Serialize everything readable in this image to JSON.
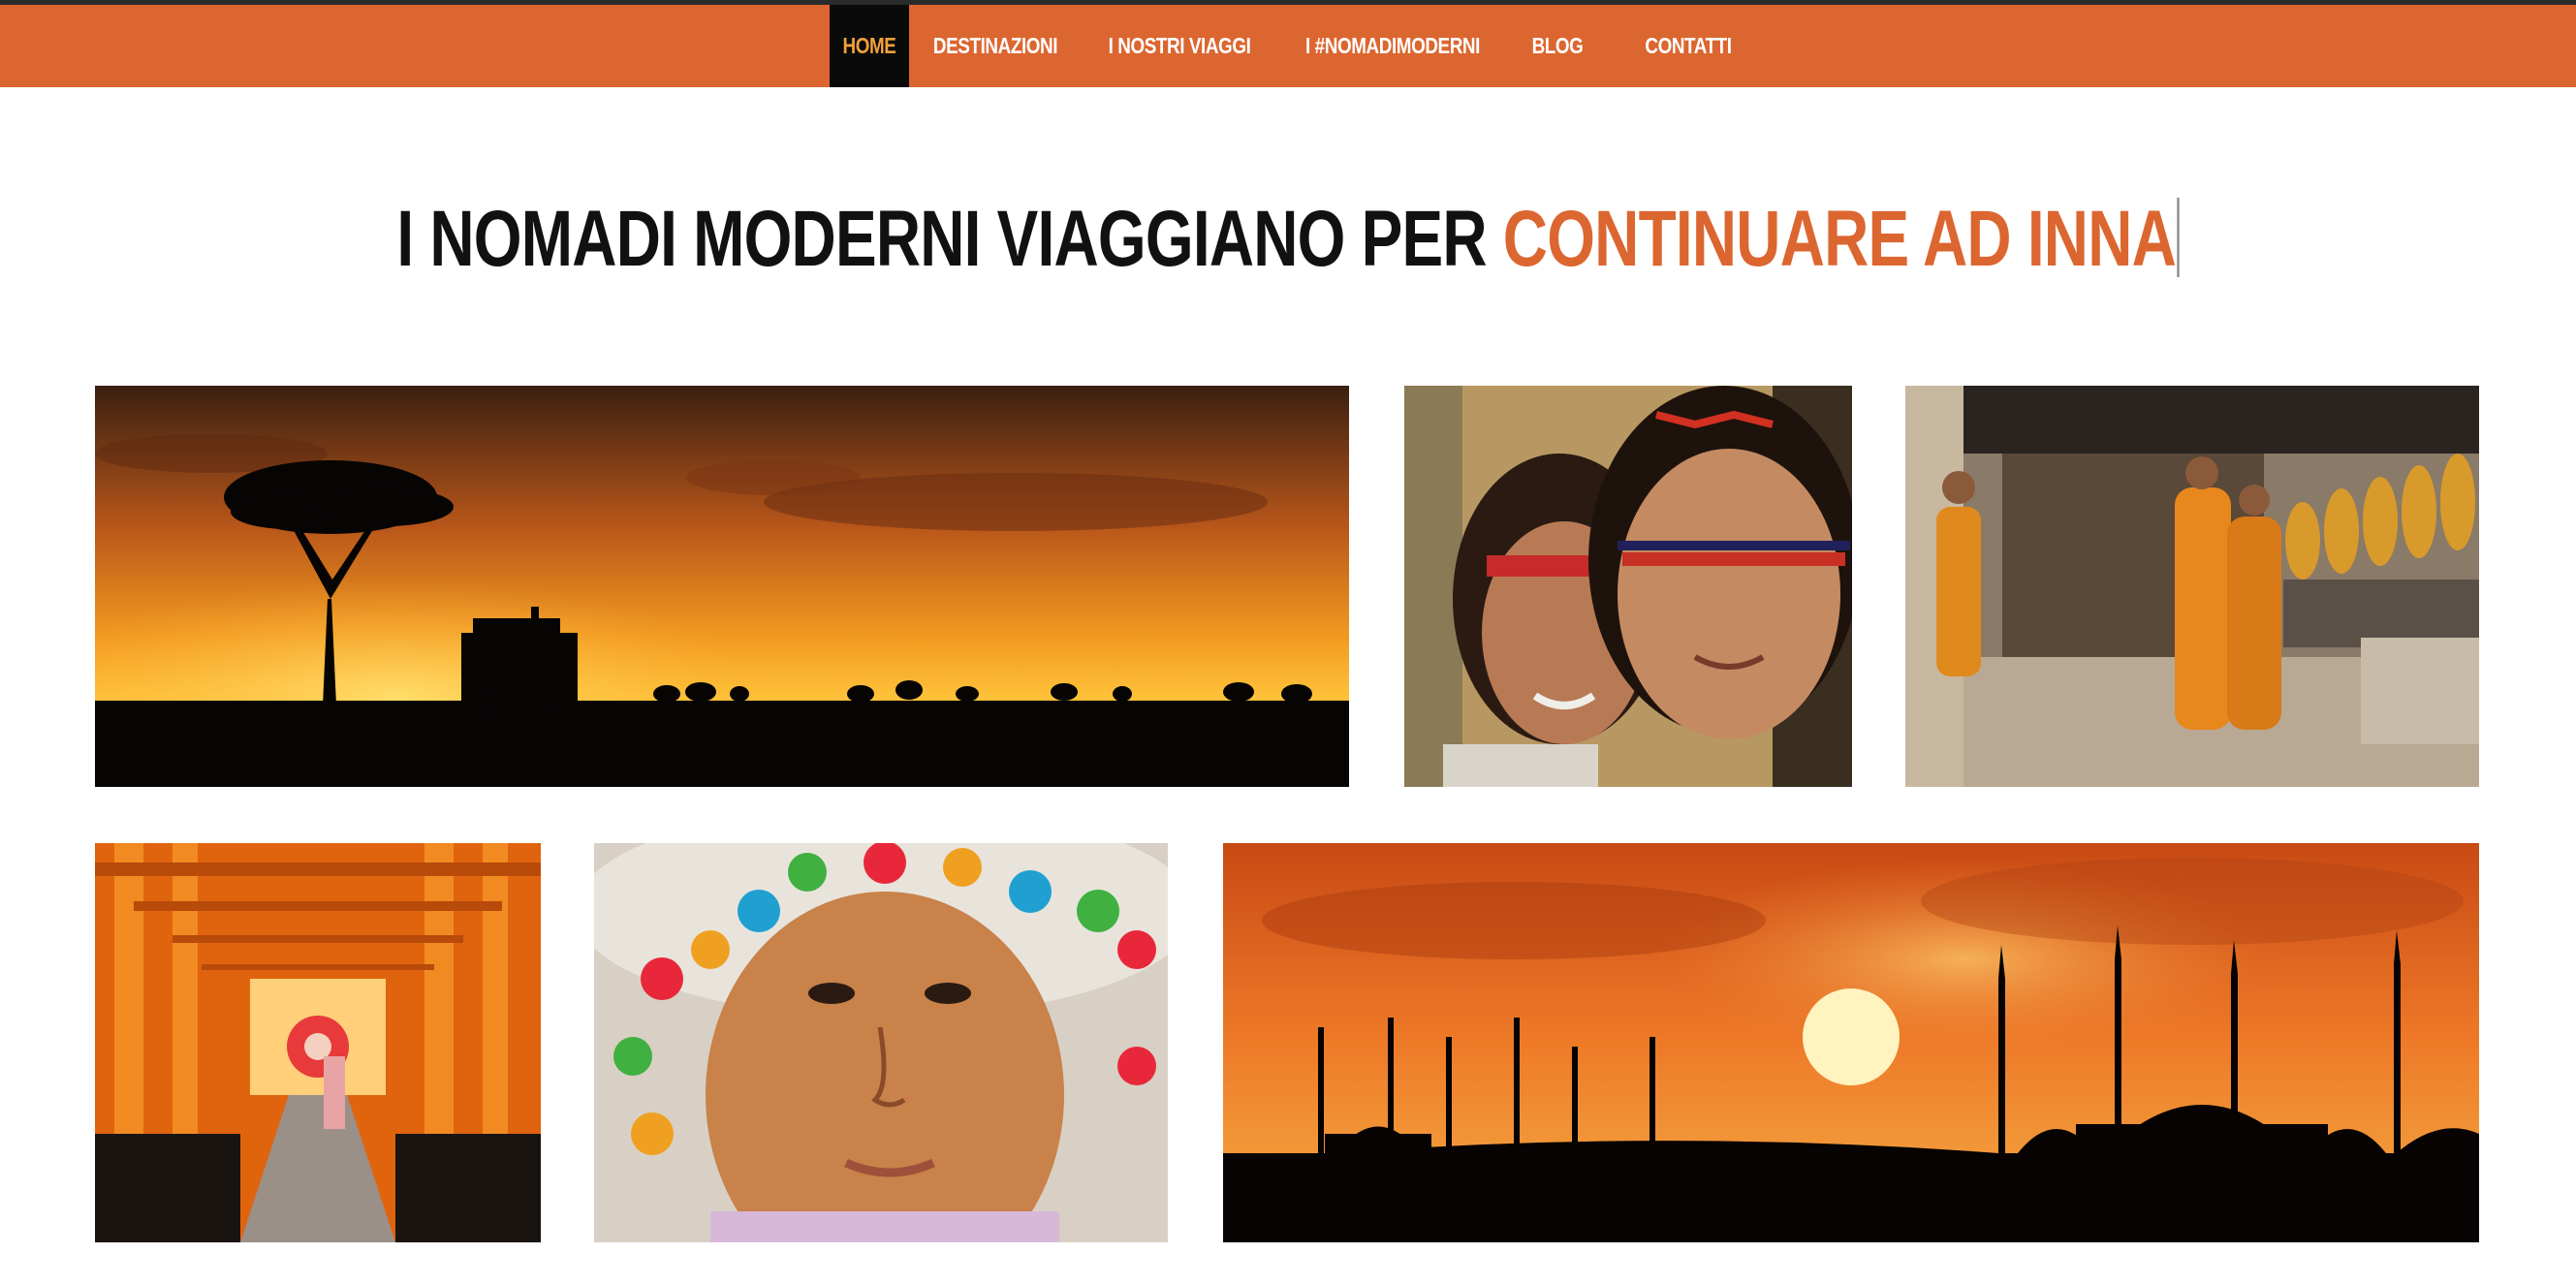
{
  "nav": {
    "items": [
      {
        "label": "HOME",
        "active": true
      },
      {
        "label": "DESTINAZIONI",
        "active": false
      },
      {
        "label": "I NOSTRI VIAGGI",
        "active": false
      },
      {
        "label": "I #NOMADIMODERNI",
        "active": false
      },
      {
        "label": "BLOG",
        "active": false
      },
      {
        "label": "CONTATTI",
        "active": false
      }
    ]
  },
  "headline": {
    "static_text": "I NOMADI MODERNI VIAGGIANO PER",
    "typed_text": "CONTINUARE AD INNA"
  },
  "colors": {
    "accent": "#dc6630",
    "active_nav_text": "#f2a03d",
    "active_nav_bg": "#0a0a0a",
    "headline_text": "#111111"
  },
  "gallery": [
    {
      "subject": "african-savanna-sunset-safari"
    },
    {
      "subject": "indigenous-women-face-paint"
    },
    {
      "subject": "monks-in-orange-robes-temple"
    },
    {
      "subject": "japanese-torii-gate-path"
    },
    {
      "subject": "child-with-colorful-hat"
    },
    {
      "subject": "mosque-skyline-sunset"
    }
  ]
}
